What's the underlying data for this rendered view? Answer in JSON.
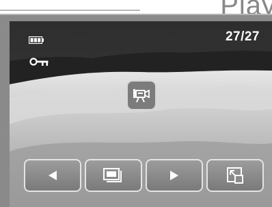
{
  "header": {
    "title_fragment": "Play"
  },
  "status": {
    "counter": "27/27",
    "battery_icon": "battery-full-icon",
    "protect_icon": "key-lock-icon"
  },
  "media": {
    "type_icon": "movie-camera-icon"
  },
  "toolbar": {
    "buttons": [
      {
        "icon": "previous-arrow-icon"
      },
      {
        "icon": "slideshow-icon"
      },
      {
        "icon": "next-arrow-icon"
      },
      {
        "icon": "zoom-magnify-icon"
      }
    ]
  },
  "colors": {
    "frame": "#8a8a8a",
    "button_border": "#e4e4e4",
    "text": "#ffffff"
  }
}
